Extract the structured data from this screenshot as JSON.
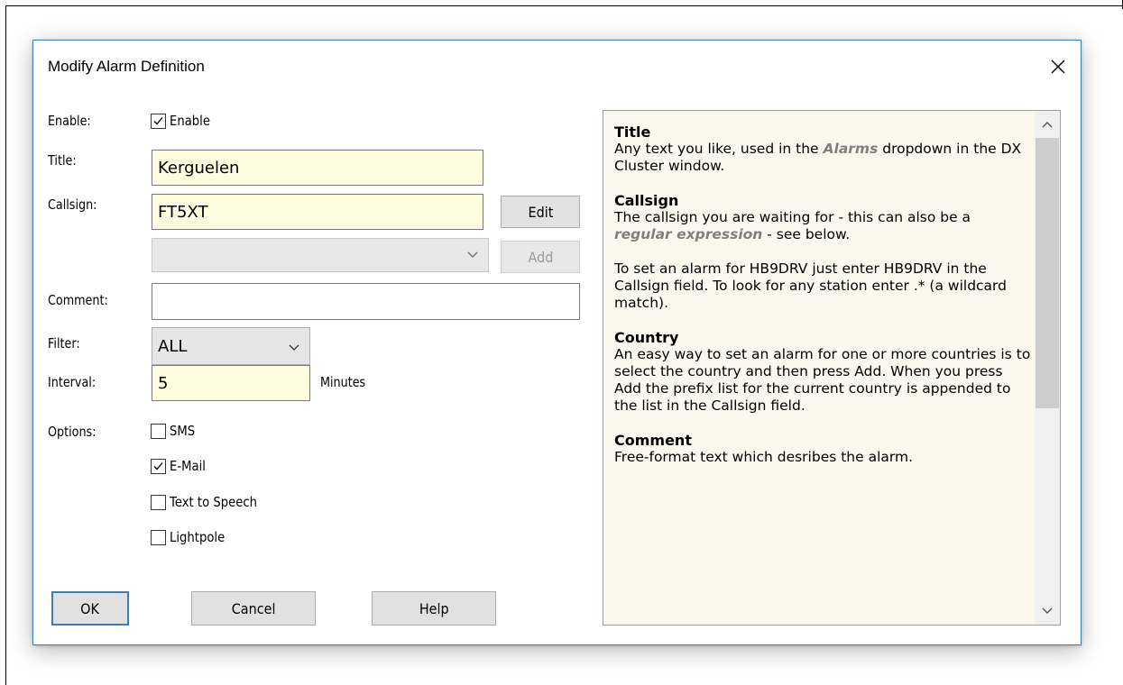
{
  "dialog": {
    "title": "Modify Alarm Definition"
  },
  "form": {
    "enable_label": "Enable:",
    "enable_checkbox_label": "Enable",
    "enable_checked": true,
    "title_label": "Title:",
    "title_value": "Kerguelen",
    "callsign_label": "Callsign:",
    "callsign_value": "FT5XT",
    "edit_button": "Edit",
    "country_value": "",
    "add_button": "Add",
    "comment_label": "Comment:",
    "comment_value": "",
    "filter_label": "Filter:",
    "filter_value": "ALL",
    "interval_label": "Interval:",
    "interval_value": "5",
    "interval_unit": "Minutes",
    "options_label": "Options:",
    "options": [
      {
        "label": "SMS",
        "checked": false
      },
      {
        "label": "E-Mail",
        "checked": true
      },
      {
        "label": "Text to Speech",
        "checked": false
      },
      {
        "label": "Lightpole",
        "checked": false
      }
    ]
  },
  "buttons": {
    "ok": "OK",
    "cancel": "Cancel",
    "help": "Help"
  },
  "help": {
    "title_heading": "Title",
    "title_text_1": "Any text you like, used in the ",
    "title_text_em": "Alarms",
    "title_text_2": " dropdown in the DX Cluster window.",
    "callsign_heading": "Callsign",
    "callsign_text_1": "The callsign you are waiting for - this can also be a ",
    "callsign_text_em": "regular expression",
    "callsign_text_2": " - see below.",
    "callsign_text_3": "To set an alarm for HB9DRV just enter HB9DRV in the Callsign field. To look for any station enter .* (a wildcard match).",
    "country_heading": "Country",
    "country_text": "An easy way to set an alarm for one or more countries is to select the country and then press Add. When you press Add the prefix list for the current country is appended to the list in the Callsign field.",
    "comment_heading": "Comment",
    "comment_text": "Free-format text which desribes the alarm."
  }
}
